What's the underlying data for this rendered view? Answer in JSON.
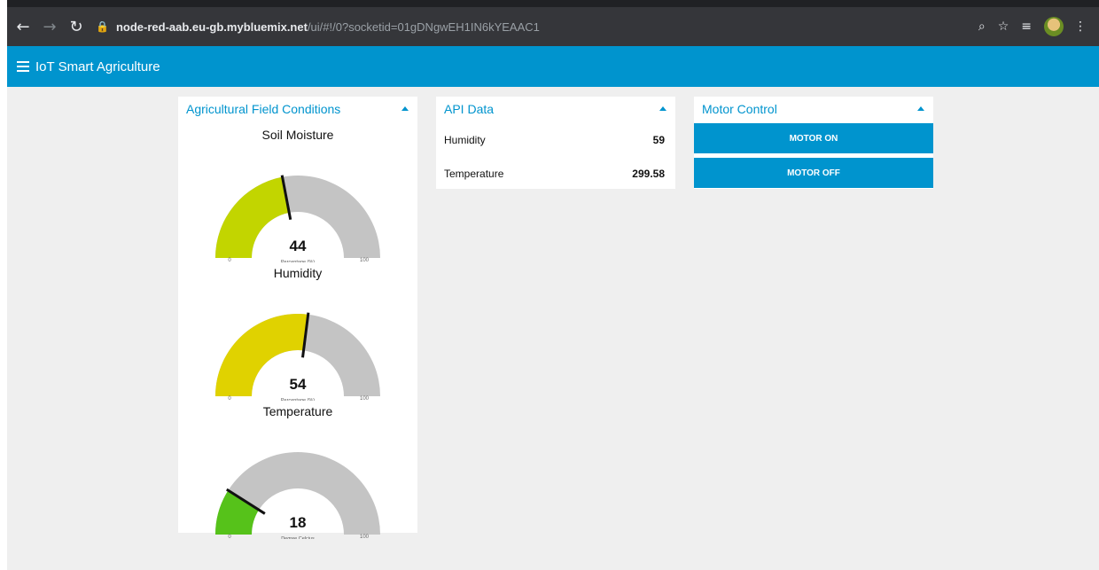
{
  "browser": {
    "url_host": "node-red-aab.eu-gb.mybluemix.net",
    "url_path": "/ui/#!/0?socketid=01gDNgwEH1IN6kYEAAC1"
  },
  "app": {
    "title": "IoT Smart Agriculture"
  },
  "field_card": {
    "title": "Agricultural Field Conditions",
    "gauges": [
      {
        "title": "Soil Moisture",
        "value": 44,
        "unit": "Percentage (%)",
        "min": 0,
        "max": 100,
        "min_label": "0",
        "max_label": "100",
        "value_label": "44",
        "color": "#c2d500"
      },
      {
        "title": "Humidity",
        "value": 54,
        "unit": "Percentage (%)",
        "min": 0,
        "max": 100,
        "min_label": "0",
        "max_label": "100",
        "value_label": "54",
        "color": "#e0d200"
      },
      {
        "title": "Temperature",
        "value": 18,
        "unit": "Degree Celcius",
        "min": 0,
        "max": 100,
        "min_label": "0",
        "max_label": "100",
        "value_label": "18",
        "color": "#56c21a"
      }
    ]
  },
  "api_card": {
    "title": "API Data",
    "rows": [
      {
        "label": "Humidity",
        "value": "59"
      },
      {
        "label": "Temperature",
        "value": "299.58"
      }
    ]
  },
  "motor_card": {
    "title": "Motor Control",
    "on_label": "MOTOR ON",
    "off_label": "MOTOR OFF"
  },
  "colors": {
    "accent": "#0094ce",
    "track": "#c4c4c4"
  }
}
